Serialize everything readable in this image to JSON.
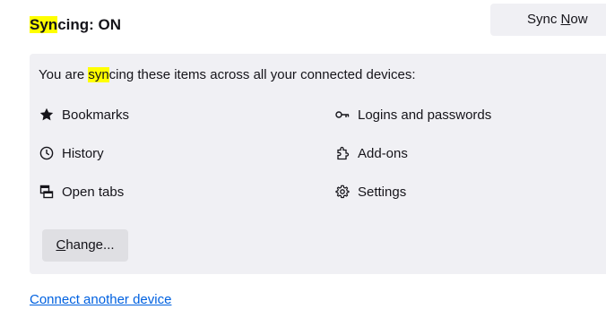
{
  "header": {
    "title_highlight": "Syn",
    "title_rest": "cing: ON",
    "sync_now_pre": "Sync ",
    "sync_now_accel": "N",
    "sync_now_post": "ow"
  },
  "panel": {
    "desc_pre": "You are ",
    "desc_highlight": "syn",
    "desc_post": "cing these items across all your connected devices:",
    "items": [
      {
        "label": "Bookmarks",
        "icon": "star-icon"
      },
      {
        "label": "Logins and passwords",
        "icon": "key-icon"
      },
      {
        "label": "History",
        "icon": "clock-icon"
      },
      {
        "label": "Add-ons",
        "icon": "puzzle-icon"
      },
      {
        "label": "Open tabs",
        "icon": "tabs-icon"
      },
      {
        "label": "Settings",
        "icon": "gear-icon"
      }
    ],
    "change_accel": "C",
    "change_rest": "hange..."
  },
  "footer": {
    "connect_link": "Connect another device"
  },
  "colors": {
    "highlight": "#ffff00",
    "panel_bg": "#f0f0f4",
    "link": "#0061e0"
  }
}
